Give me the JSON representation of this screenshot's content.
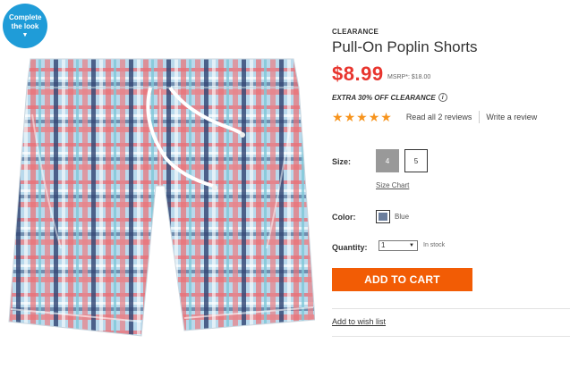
{
  "badge": {
    "label": "Complete the look",
    "arrow": "▼"
  },
  "product": {
    "eyebrow": "CLEARANCE",
    "title": "Pull-On Poplin Shorts",
    "price": "$8.99",
    "msrp": "MSRP*: $18.00",
    "promo": "EXTRA 30% OFF CLEARANCE",
    "info_icon_glyph": "i"
  },
  "rating": {
    "stars": 5,
    "reviews_link": "Read all 2 reviews",
    "write_link": "Write a review"
  },
  "size": {
    "label": "Size:",
    "options": [
      "4",
      "5"
    ],
    "selected": "4",
    "chart_link": "Size Chart"
  },
  "color": {
    "label": "Color:",
    "name": "Blue",
    "swatch_hex": "#6a7d9c"
  },
  "quantity": {
    "label": "Quantity:",
    "value": "1",
    "stock": "In stock"
  },
  "actions": {
    "add_to_cart": "ADD TO CART",
    "wishlist": "Add to wish list"
  },
  "colors": {
    "price": "#e8352e",
    "cta": "#f25c05",
    "badge": "#1f9cd8",
    "stars": "#f7941d"
  },
  "image": {
    "alt_icon": "plaid-shorts-image"
  }
}
